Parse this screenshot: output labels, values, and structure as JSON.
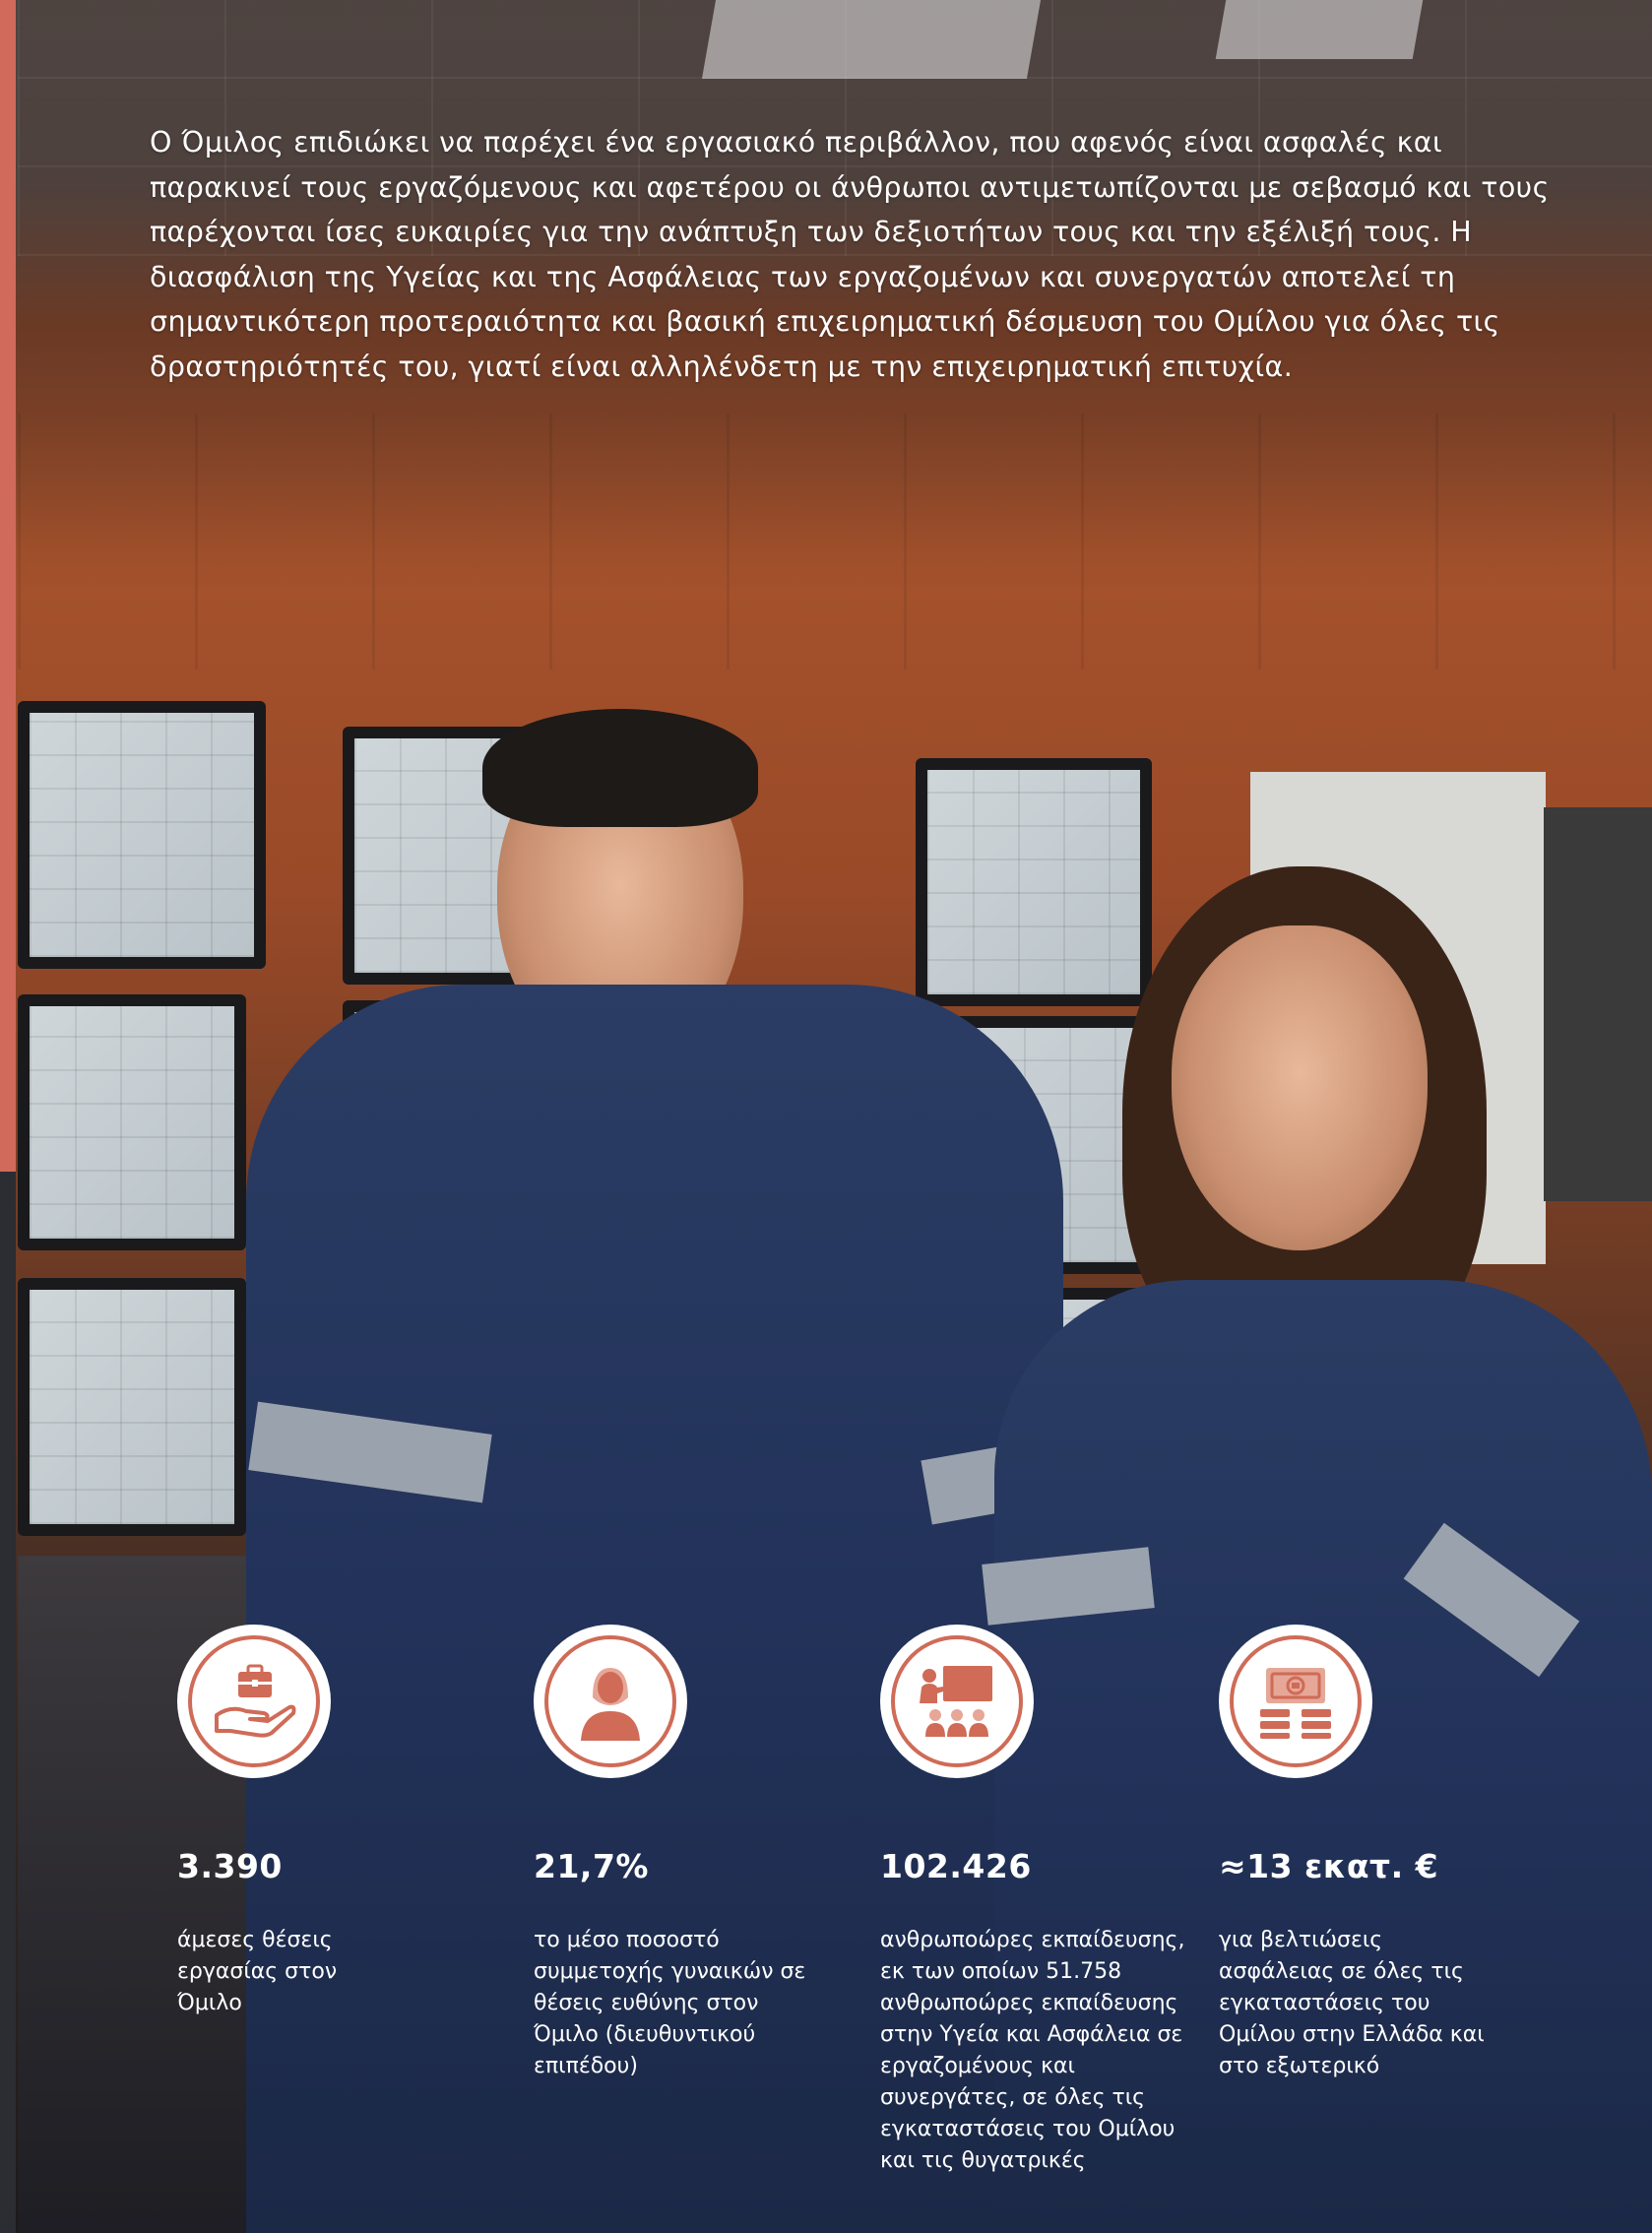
{
  "intro_text": "Ο Όμιλος επιδιώκει να παρέχει ένα εργασιακό περιβάλλον, που αφενός είναι ασφαλές και παρακινεί τους εργαζόμενους και αφετέρου οι άνθρωποι αντιμετωπίζονται με σεβασμό και τους παρέχονται ίσες ευκαιρίες για την ανάπτυξη των δεξιοτήτων τους και την εξέλιξή τους. Η διασφάλιση της Υγείας και της Ασφάλειας των εργαζομένων και συνεργατών αποτελεί τη σημαντικότερη προτεραιότητα και βασική επιχειρηματική δέσμευση του Ομίλου για όλες τις δραστηριότητές του, γιατί είναι αλληλένδετη με την επιχειρηματική επιτυχία.",
  "colors": {
    "accent": "#cf6b57",
    "text": "#ffffff",
    "side_bar": "#d06a5a"
  },
  "stats": [
    {
      "icon": "briefcase-hand-icon",
      "value": "3.390",
      "description": "άμεσες θέσεις εργασίας στον Όμιλο"
    },
    {
      "icon": "woman-icon",
      "value": "21,7%",
      "description": "το μέσο ποσοστό συμμετοχής γυναικών σε θέσεις ευθύνης στον Όμιλο (διευθυντικού επιπέδου)"
    },
    {
      "icon": "training-icon",
      "value": "102.426",
      "description": "ανθρωποώρες εκπαίδευσης, εκ των οποίων 51.758 ανθρωποώρες εκπαίδευσης στην Υγεία και Ασφάλεια σε εργαζομένους και συνεργάτες, σε όλες τις εγκαταστάσεις του Ομίλου και τις θυγατρικές"
    },
    {
      "icon": "money-stack-icon",
      "value": "≈13 εκατ. €",
      "description": "για βελτιώσεις ασφάλειας σε όλες τις εγκαταστάσεις του Ομίλου στην Ελλάδα και στο εξωτερικό"
    }
  ]
}
